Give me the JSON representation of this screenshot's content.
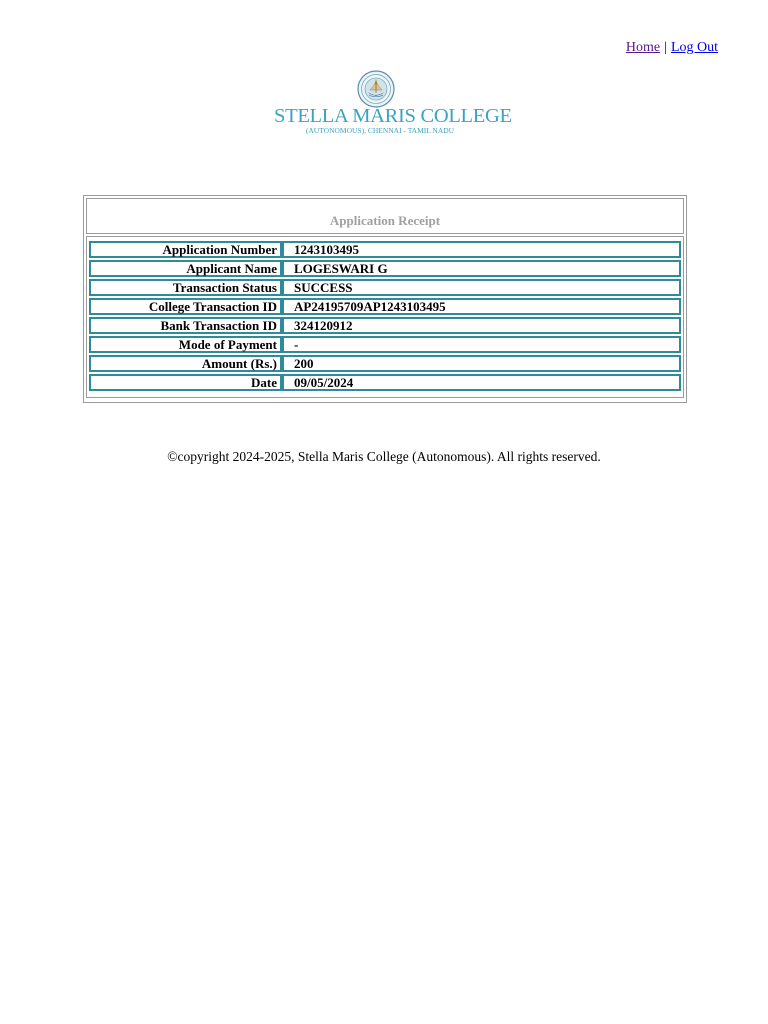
{
  "nav": {
    "home_label": "Home",
    "separator": "|",
    "logout_label": "Log Out"
  },
  "logo": {
    "name": "STELLA MARIS COLLEGE",
    "subtitle": "(AUTONOMOUS), CHENNAI - TAMIL NADU"
  },
  "receipt": {
    "title": "Application Receipt",
    "rows": [
      {
        "label": "Application Number",
        "value": "1243103495"
      },
      {
        "label": "Applicant Name",
        "value": "LOGESWARI G"
      },
      {
        "label": "Transaction Status",
        "value": "SUCCESS"
      },
      {
        "label": "College Transaction ID",
        "value": "AP24195709AP1243103495"
      },
      {
        "label": "Bank Transaction ID",
        "value": "324120912"
      },
      {
        "label": "Mode of Payment",
        "value": "-"
      },
      {
        "label": "Amount (Rs.)",
        "value": "200"
      },
      {
        "label": "Date",
        "value": "09/05/2024"
      }
    ]
  },
  "footer": {
    "text": "©copyright 2024-2025, Stella Maris College (Autonomous). All rights reserved."
  },
  "colors": {
    "brand": "#3aa3c4",
    "row_border": "#2e8b99",
    "visited_link": "#551a8b",
    "link": "#0000ee"
  }
}
